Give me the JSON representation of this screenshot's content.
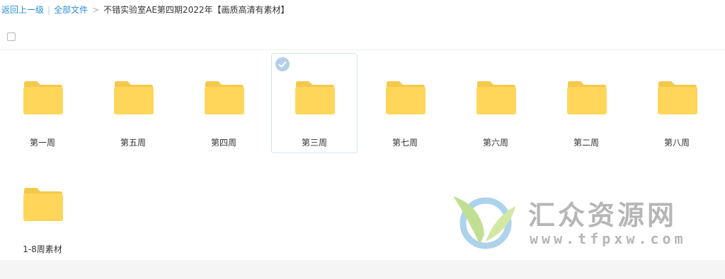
{
  "breadcrumb": {
    "back_label": "返回上一级",
    "all_files_label": "全部文件",
    "current_folder": "不错实验室AE第四期2022年【画质高清有素材】",
    "separator_bar": "|",
    "separator_arrow": ">"
  },
  "folders": [
    {
      "name": "第一周",
      "selected": false
    },
    {
      "name": "第五周",
      "selected": false
    },
    {
      "name": "第四周",
      "selected": false
    },
    {
      "name": "第三周",
      "selected": true
    },
    {
      "name": "第七周",
      "selected": false
    },
    {
      "name": "第六周",
      "selected": false
    },
    {
      "name": "第二周",
      "selected": false
    },
    {
      "name": "第八周",
      "selected": false
    },
    {
      "name": "1-8周素材",
      "selected": false
    }
  ],
  "watermark": {
    "title": "汇众资源网",
    "url": "www.tfpxw.com"
  },
  "colors": {
    "link": "#2a8fd8",
    "folder_body": "#ffd65a",
    "folder_tab": "#f4c84a",
    "selected_border": "#d3e6f6",
    "check_bg": "#b6cfe8"
  },
  "icons": {
    "folder": "folder-icon",
    "check": "check-icon",
    "select_all": "checkbox-icon"
  }
}
